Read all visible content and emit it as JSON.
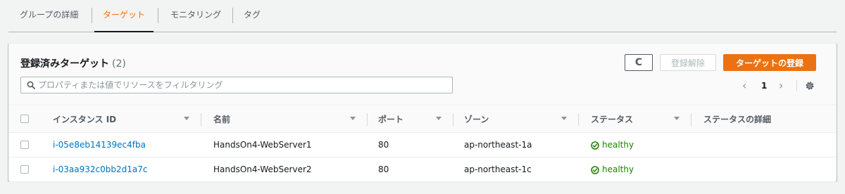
{
  "tabs": [
    {
      "label": "グループの詳細",
      "active": false
    },
    {
      "label": "ターゲット",
      "active": true
    },
    {
      "label": "モニタリング",
      "active": false
    },
    {
      "label": "タグ",
      "active": false
    }
  ],
  "panel": {
    "title": "登録済みターゲット",
    "count": "(2)",
    "deregister_label": "登録解除",
    "register_label": "ターゲットの登録",
    "refresh_glyph": "C"
  },
  "search": {
    "placeholder": "プロパティまたは値でリソースをフィルタリング",
    "value": ""
  },
  "pagination": {
    "prev": "‹",
    "current_page": "1",
    "next": "›"
  },
  "table": {
    "columns": [
      "インスタンス ID",
      "名前",
      "ポート",
      "ゾーン",
      "ステータス",
      "ステータスの詳細"
    ],
    "rows": [
      {
        "instance_id": "i-05e8eb14139ec4fba",
        "name": "HandsOn4-WebServer1",
        "port": "80",
        "zone": "ap-northeast-1a",
        "status": "healthy",
        "status_detail": ""
      },
      {
        "instance_id": "i-03aa932c0bb2d1a7c",
        "name": "HandsOn4-WebServer2",
        "port": "80",
        "zone": "ap-northeast-1c",
        "status": "healthy",
        "status_detail": ""
      }
    ]
  },
  "colors": {
    "accent": "#ec7211",
    "link": "#0073bb",
    "healthy": "#1d8102"
  },
  "icons": {
    "refresh": "refresh-icon",
    "search": "search-icon",
    "settings": "gear-icon",
    "status": "status-positive-icon"
  }
}
